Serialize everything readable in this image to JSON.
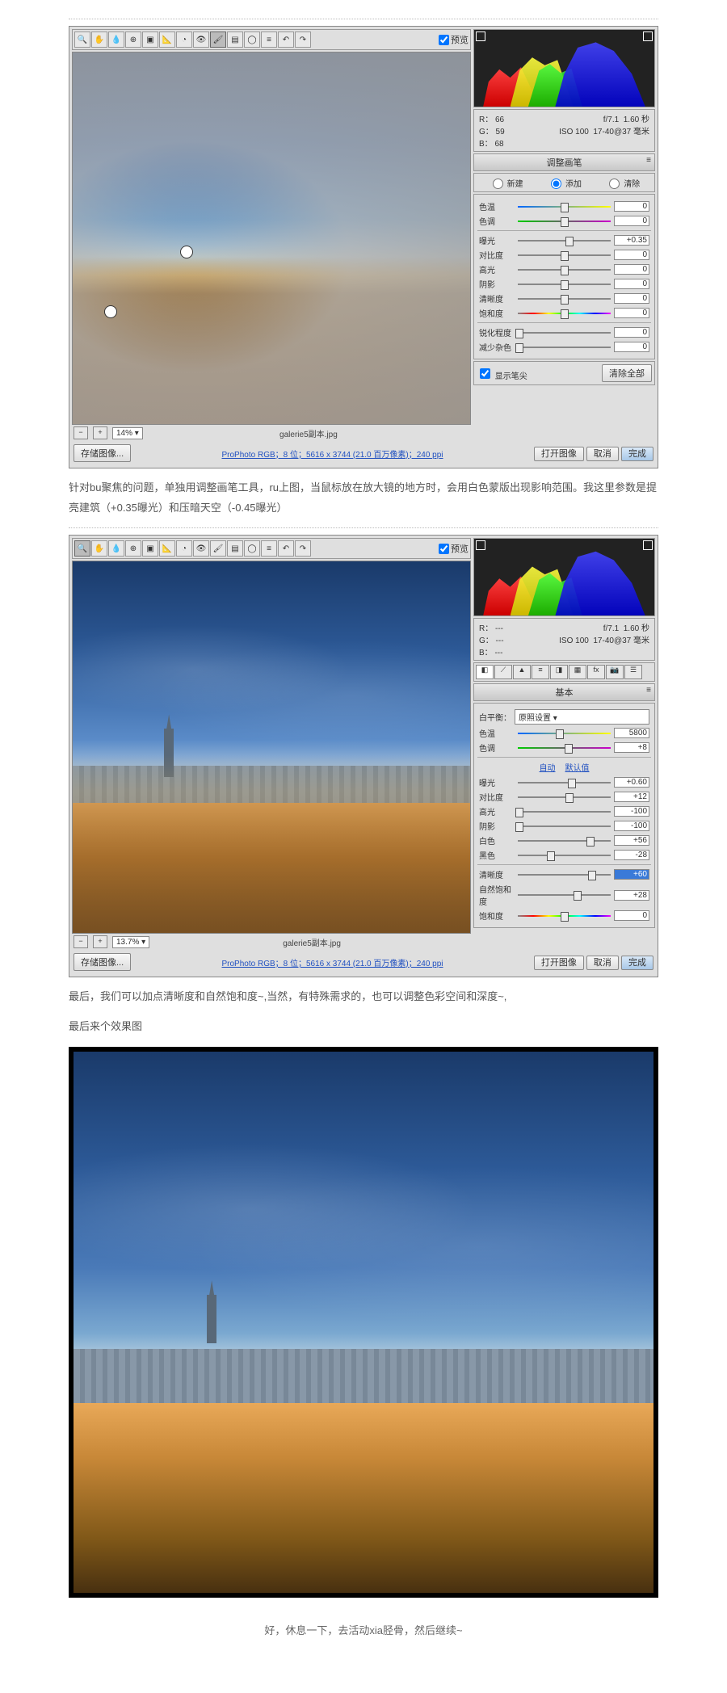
{
  "acr1": {
    "preview_label": "预览",
    "filename": "galerie5副本.jpg",
    "zoom": "14%",
    "profile": "ProPhoto RGB；8 位；5616 x 3744 (21.0 百万像素)；240 ppi",
    "save": "存储图像...",
    "open": "打开图像",
    "cancel": "取消",
    "done": "完成",
    "rgb": {
      "r": "R：  66",
      "g": "G：  59",
      "b": "B：  68"
    },
    "exif": "f/7.1  1.60 秒\nISO 100  17-40@37 毫米",
    "panel_title": "调整画笔",
    "radio1": "新建",
    "radio2": "添加",
    "radio3": "清除",
    "sliders": [
      {
        "label": "色温",
        "val": "0",
        "pos": 50,
        "cls": "temp"
      },
      {
        "label": "色调",
        "val": "0",
        "pos": 50,
        "cls": "tint"
      },
      {
        "label": "曝光",
        "val": "+0.35",
        "pos": 56
      },
      {
        "label": "对比度",
        "val": "0",
        "pos": 50
      },
      {
        "label": "高光",
        "val": "0",
        "pos": 50
      },
      {
        "label": "阴影",
        "val": "0",
        "pos": 50
      },
      {
        "label": "清晰度",
        "val": "0",
        "pos": 50
      },
      {
        "label": "饱和度",
        "val": "0",
        "pos": 50,
        "cls": "sat"
      },
      {
        "label": "锐化程度",
        "val": "0",
        "pos": 2
      },
      {
        "label": "减少杂色",
        "val": "0",
        "pos": 2
      }
    ],
    "show_needle": "显示笔尖",
    "clear_all": "清除全部"
  },
  "caption1": "针对bu聚焦的问题，单独用调整画笔工具，ru上图，当鼠标放在放大镜的地方时，会用白色蒙版出现影响范围。我这里参数是提亮建筑（+0.35曝光）和压暗天空（-0.45曝光）",
  "acr2": {
    "preview_label": "预览",
    "filename": "galerie5副本.jpg",
    "zoom": "13.7%",
    "profile": "ProPhoto RGB；8 位；5616 x 3744 (21.0 百万像素)；240 ppi",
    "save": "存储图像...",
    "open": "打开图像",
    "cancel": "取消",
    "done": "完成",
    "rgb": {
      "r": "R：  ---",
      "g": "G：  ---",
      "b": "B：  ---"
    },
    "exif": "f/7.1  1.60 秒\nISO 100  17-40@37 毫米",
    "panel_title": "基本",
    "wb_label": "白平衡：",
    "wb_value": "原照设置",
    "auto": "自动",
    "default": "默认值",
    "groups": {
      "g1": [
        {
          "label": "色温",
          "val": "5800",
          "pos": 45,
          "cls": "temp"
        },
        {
          "label": "色调",
          "val": "+8",
          "pos": 55,
          "cls": "tint"
        }
      ],
      "g2": [
        {
          "label": "曝光",
          "val": "+0.60",
          "pos": 58
        },
        {
          "label": "对比度",
          "val": "+12",
          "pos": 56
        },
        {
          "label": "高光",
          "val": "-100",
          "pos": 2
        },
        {
          "label": "阴影",
          "val": "-100",
          "pos": 2
        },
        {
          "label": "白色",
          "val": "+56",
          "pos": 78
        },
        {
          "label": "黑色",
          "val": "-28",
          "pos": 36
        }
      ],
      "g3": [
        {
          "label": "清晰度",
          "val": "+60",
          "pos": 80,
          "hl": true
        },
        {
          "label": "自然饱和度",
          "val": "+28",
          "pos": 64
        },
        {
          "label": "饱和度",
          "val": "0",
          "pos": 50,
          "cls": "sat"
        }
      ]
    }
  },
  "caption2a": "最后，我们可以加点清晰度和自然饱和度~,当然，有特殊需求的，也可以调整色彩空间和深度~,",
  "caption2b": "最后来个效果图",
  "footer": "好，休息一下，去活动xia胫骨，然后继续~"
}
